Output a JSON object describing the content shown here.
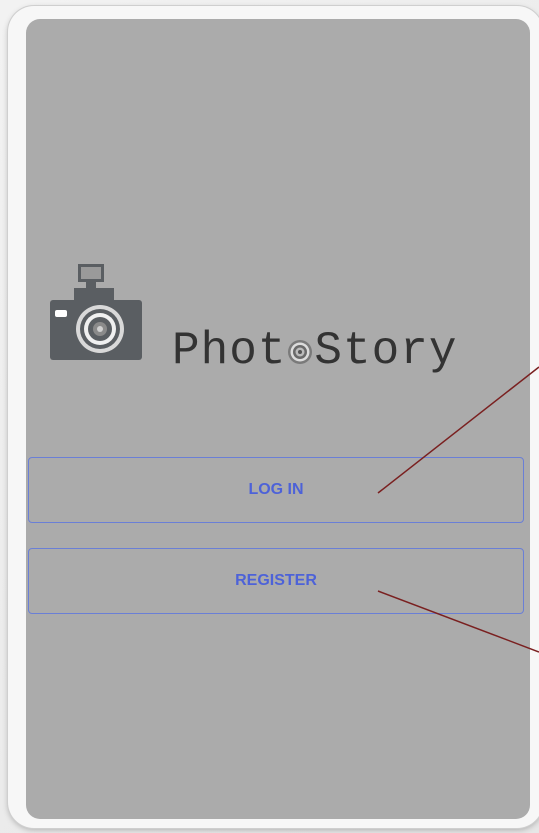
{
  "app": {
    "brand_prefix": "Phot",
    "brand_suffix": "Story",
    "logo_icon": "camera-icon"
  },
  "actions": {
    "login_label": "LOG IN",
    "register_label": "REGISTER"
  },
  "colors": {
    "screen_bg": "#ababab",
    "button_text": "#4d62d8",
    "button_border": "#6a7fd6",
    "annotation_arrow": "#7a2020"
  }
}
